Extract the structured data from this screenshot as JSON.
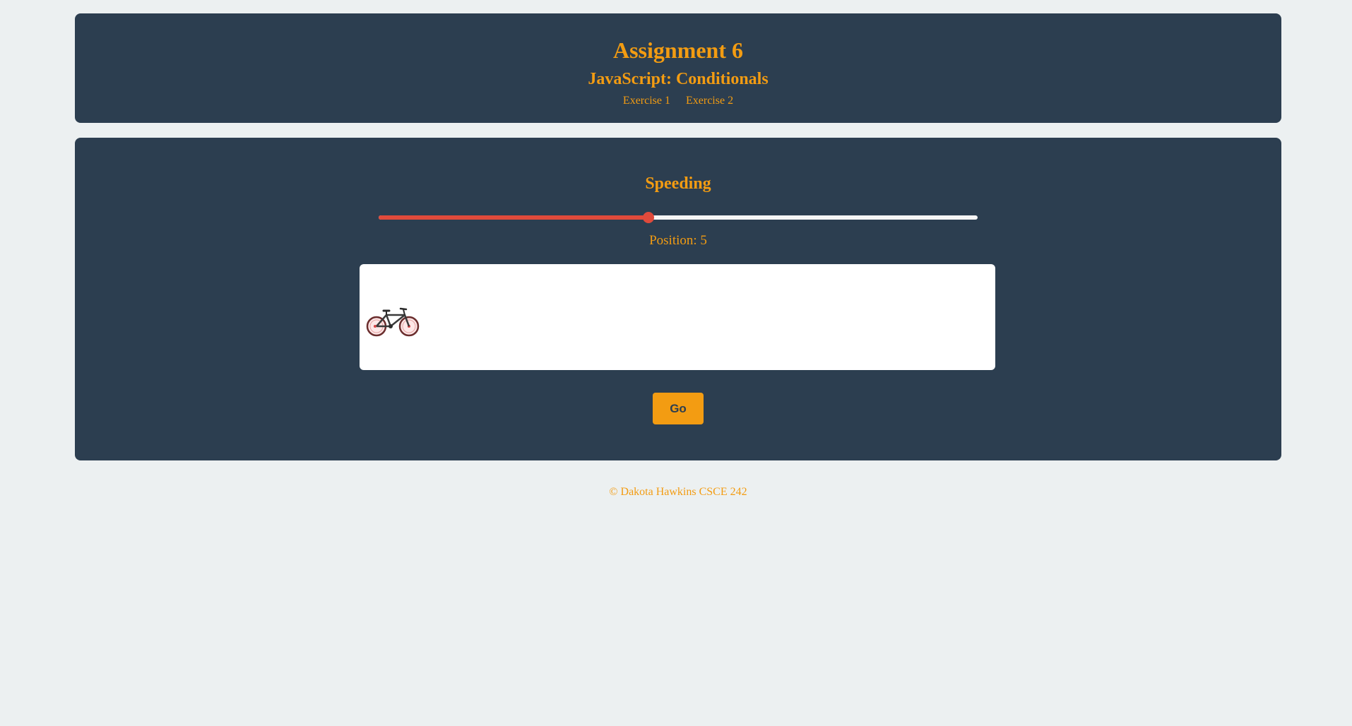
{
  "header": {
    "title": "Assignment 6",
    "subtitle": "JavaScript: Conditionals",
    "nav": [
      {
        "label": "Exercise 1"
      },
      {
        "label": "Exercise 2"
      }
    ]
  },
  "main": {
    "section_title": "Speeding",
    "slider": {
      "fill_fraction": 0.45
    },
    "position_text": "Position: 5",
    "go_label": "Go"
  },
  "footer": {
    "text": "© Dakota Hawkins CSCE 242"
  },
  "colors": {
    "background": "#ecf0f1",
    "panel": "#2c3e50",
    "accent": "#f39c12",
    "slider_fill": "#e04a3b",
    "slider_track": "#f5f5f5"
  },
  "icons": {
    "vehicle": "bicycle-icon"
  }
}
